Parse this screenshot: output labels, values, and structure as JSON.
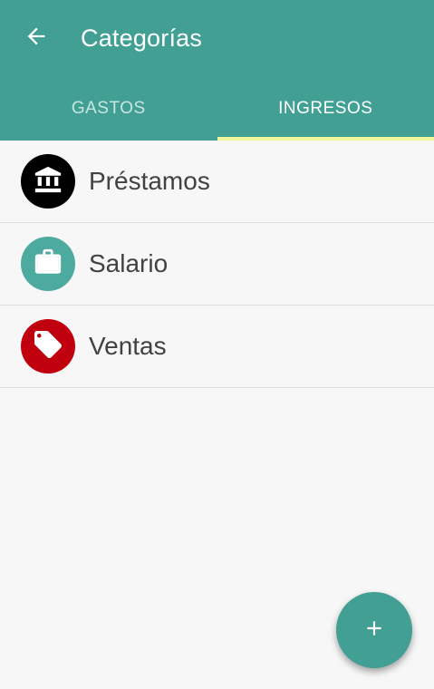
{
  "header": {
    "title": "Categorías",
    "back_icon": "arrow-left-icon"
  },
  "tabs": [
    {
      "label": "GASTOS",
      "active": false
    },
    {
      "label": "INGRESOS",
      "active": true
    }
  ],
  "categories": [
    {
      "label": "Préstamos",
      "icon": "bank-icon",
      "color": "#000000"
    },
    {
      "label": "Salario",
      "icon": "briefcase-icon",
      "color": "#4daa9f"
    },
    {
      "label": "Ventas",
      "icon": "tag-icon",
      "color": "#c0000e"
    }
  ],
  "fab": {
    "icon": "plus-icon"
  },
  "colors": {
    "primary": "#41a093",
    "tab_indicator": "#eef59c",
    "background": "#f7f7f7"
  }
}
